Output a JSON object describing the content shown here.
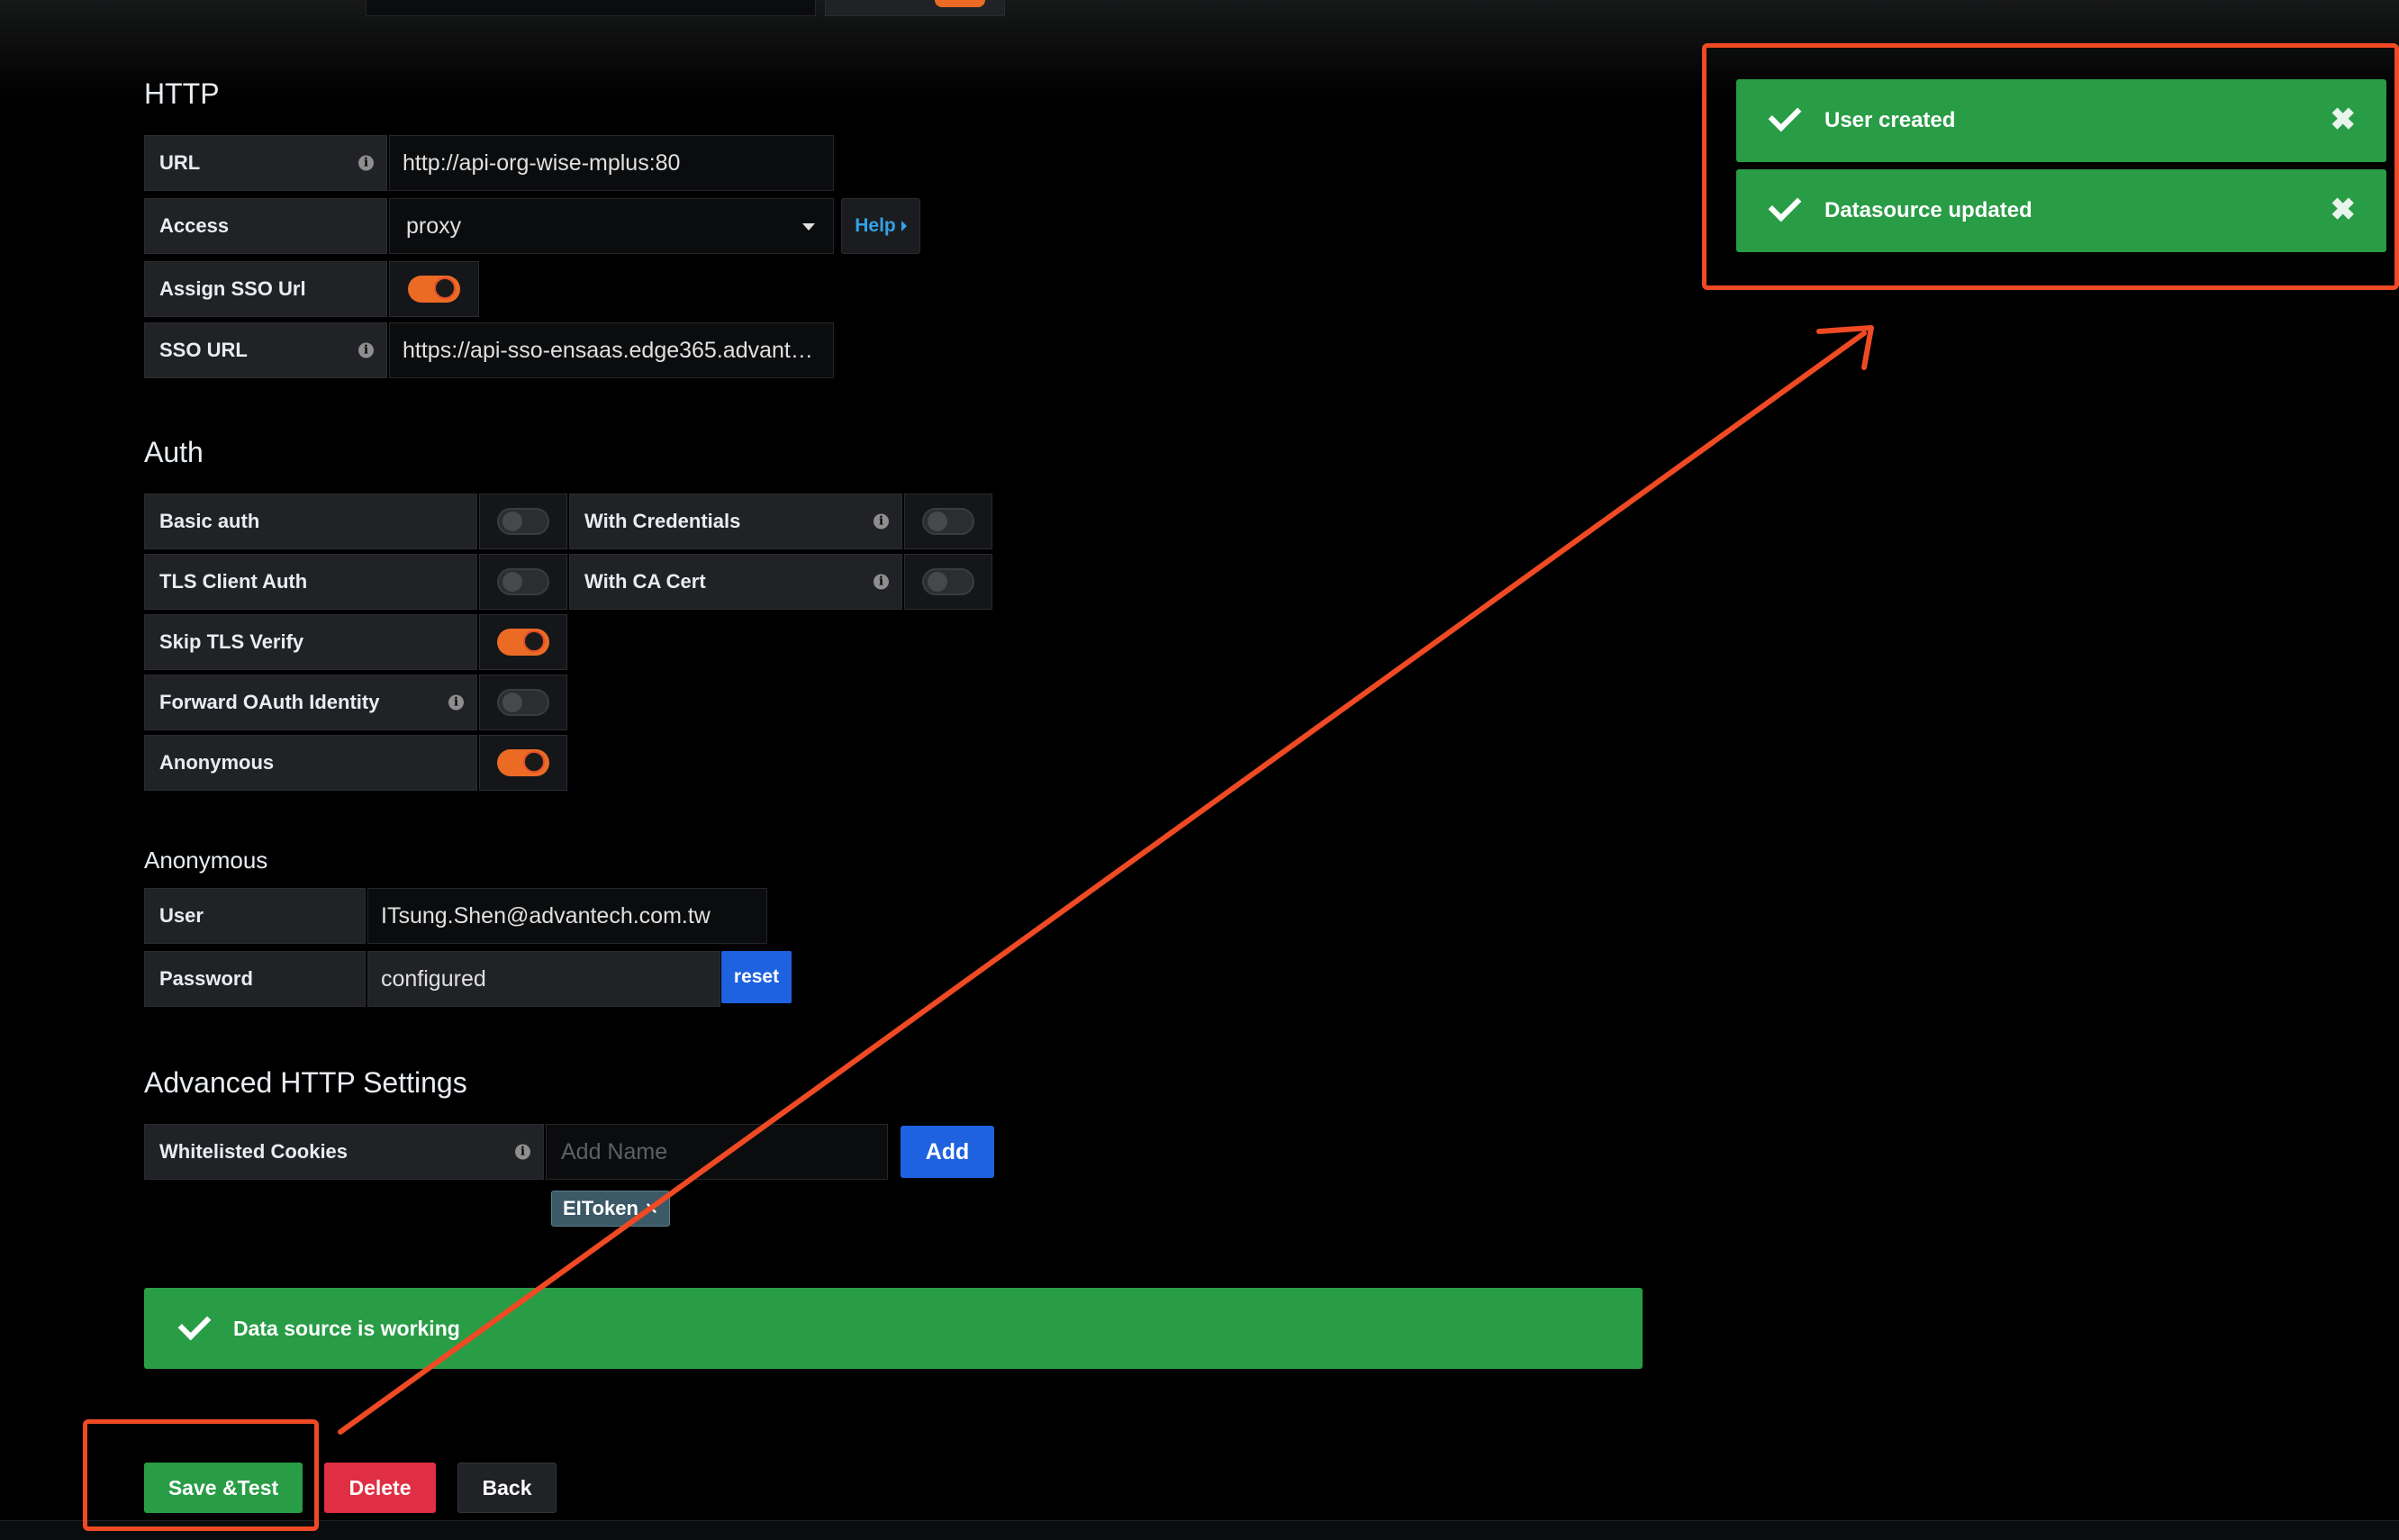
{
  "http": {
    "title": "HTTP",
    "url_label": "URL",
    "url_value": "http://api-org-wise-mplus:80",
    "access_label": "Access",
    "access_value": "proxy",
    "help_label": "Help",
    "assign_sso_label": "Assign SSO Url",
    "assign_sso_on": true,
    "sso_url_label": "SSO URL",
    "sso_url_value": "https://api-sso-ensaas.edge365.advant…"
  },
  "auth": {
    "title": "Auth",
    "basic_auth": "Basic auth",
    "with_credentials": "With Credentials",
    "tls_client_auth": "TLS Client Auth",
    "with_ca_cert": "With CA Cert",
    "skip_tls_verify": "Skip TLS Verify",
    "forward_oauth": "Forward OAuth Identity",
    "anonymous": "Anonymous"
  },
  "anonymous": {
    "title": "Anonymous",
    "user_label": "User",
    "user_value": "ITsung.Shen@advantech.com.tw",
    "password_label": "Password",
    "password_value": "configured",
    "reset_label": "reset"
  },
  "advanced": {
    "title": "Advanced HTTP Settings",
    "cookies_label": "Whitelisted Cookies",
    "cookies_placeholder": "Add Name",
    "add_label": "Add",
    "tag_label": "EIToken",
    "tag_remove": "×"
  },
  "status": {
    "message": "Data source is working"
  },
  "actions": {
    "save_test": "Save &Test",
    "delete": "Delete",
    "back": "Back"
  },
  "toasts": [
    {
      "text": "User created"
    },
    {
      "text": "Datasource updated"
    }
  ],
  "colors": {
    "success": "#299c46",
    "danger": "#e02f44",
    "primary": "#1f62e0",
    "toggle_on": "#eb6b25",
    "annotation": "#ef4a24"
  }
}
